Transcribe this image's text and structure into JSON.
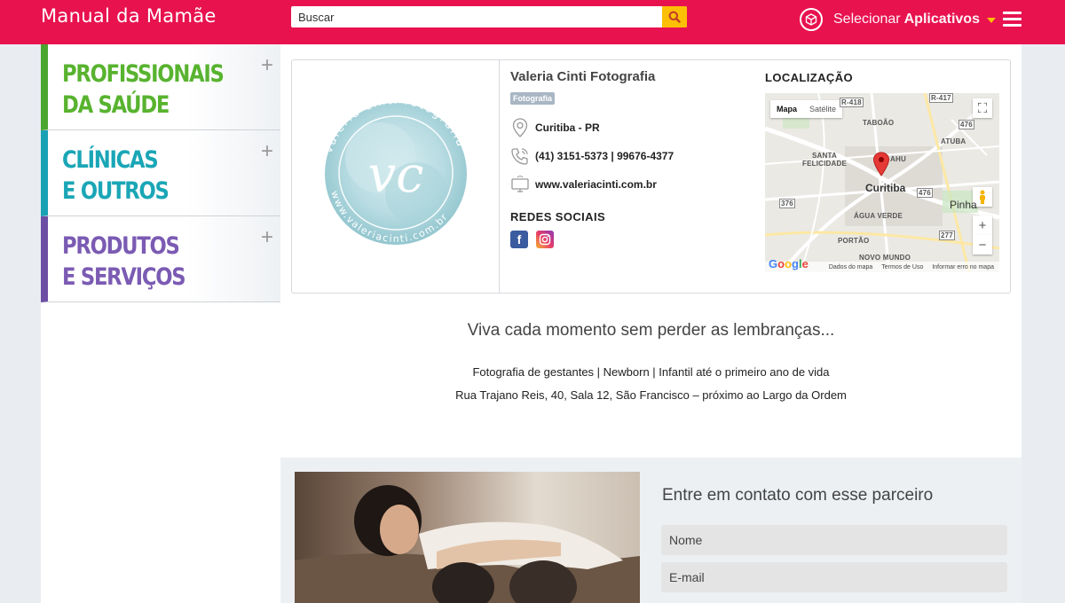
{
  "header": {
    "logo": "Manual da Mamãe",
    "search_placeholder": "Buscar",
    "apps_label_prefix": "Selecionar",
    "apps_label_bold": "Aplicativos"
  },
  "sidebar": {
    "categories": [
      {
        "title": "PROFISSIONAIS\nDA SAÚDE",
        "toggle": "+"
      },
      {
        "title": "CLÍNICAS\nE OUTROS",
        "toggle": "+"
      },
      {
        "title": "PRODUTOS\nE SERVIÇOS",
        "toggle": "+"
      }
    ]
  },
  "business": {
    "name": "Valeria Cinti Fotografia",
    "tag": "Fotografia",
    "location": "Curitiba - PR",
    "phone": "(41) 3151-5373 | 99676-4377",
    "website": "www.valeriacinti.com.br",
    "social_title": "REDES SOCIAIS",
    "logo_monogram": "vc",
    "logo_ring_text": "valeria cinti fotografia",
    "logo_ring_url": "www.valeriacinti.com.br"
  },
  "map": {
    "title": "LOCALIZAÇÃO",
    "tab_map": "Mapa",
    "tab_satellite": "Satélite",
    "labels": [
      "TABOÃO",
      "ATUBA",
      "SANTA\nFELICIDADE",
      "ÁGUA VERDE",
      "PORTÃO",
      "NOVO MUNDO",
      "AHU"
    ],
    "city": "Curitiba",
    "city2": "Pinha",
    "road_labels": [
      "476",
      "376",
      "476",
      "277"
    ],
    "road_top_labels": [
      "R-418",
      "R-417"
    ],
    "zoom_in": "+",
    "zoom_out": "−",
    "footer": [
      "Dados do mapa",
      "Termos de Uso",
      "Informar erro no mapa"
    ],
    "google": "Google"
  },
  "content": {
    "tagline": "Viva cada momento sem perder as lembranças...",
    "line1": "Fotografia de gestantes | Newborn | Infantil até o primeiro ano de vida",
    "line2": "Rua Trajano Reis, 40, Sala 12, São Francisco – próximo ao Largo da Ordem"
  },
  "contact": {
    "title": "Entre em contato com esse parceiro",
    "name_placeholder": "Nome",
    "email_placeholder": "E-mail"
  },
  "colors": {
    "brand": "#e8124f",
    "search_button": "#fdbf05",
    "cat_saude": "#58b32f",
    "cat_clinicas": "#1aa6b6",
    "cat_produtos": "#7b5bb3"
  }
}
